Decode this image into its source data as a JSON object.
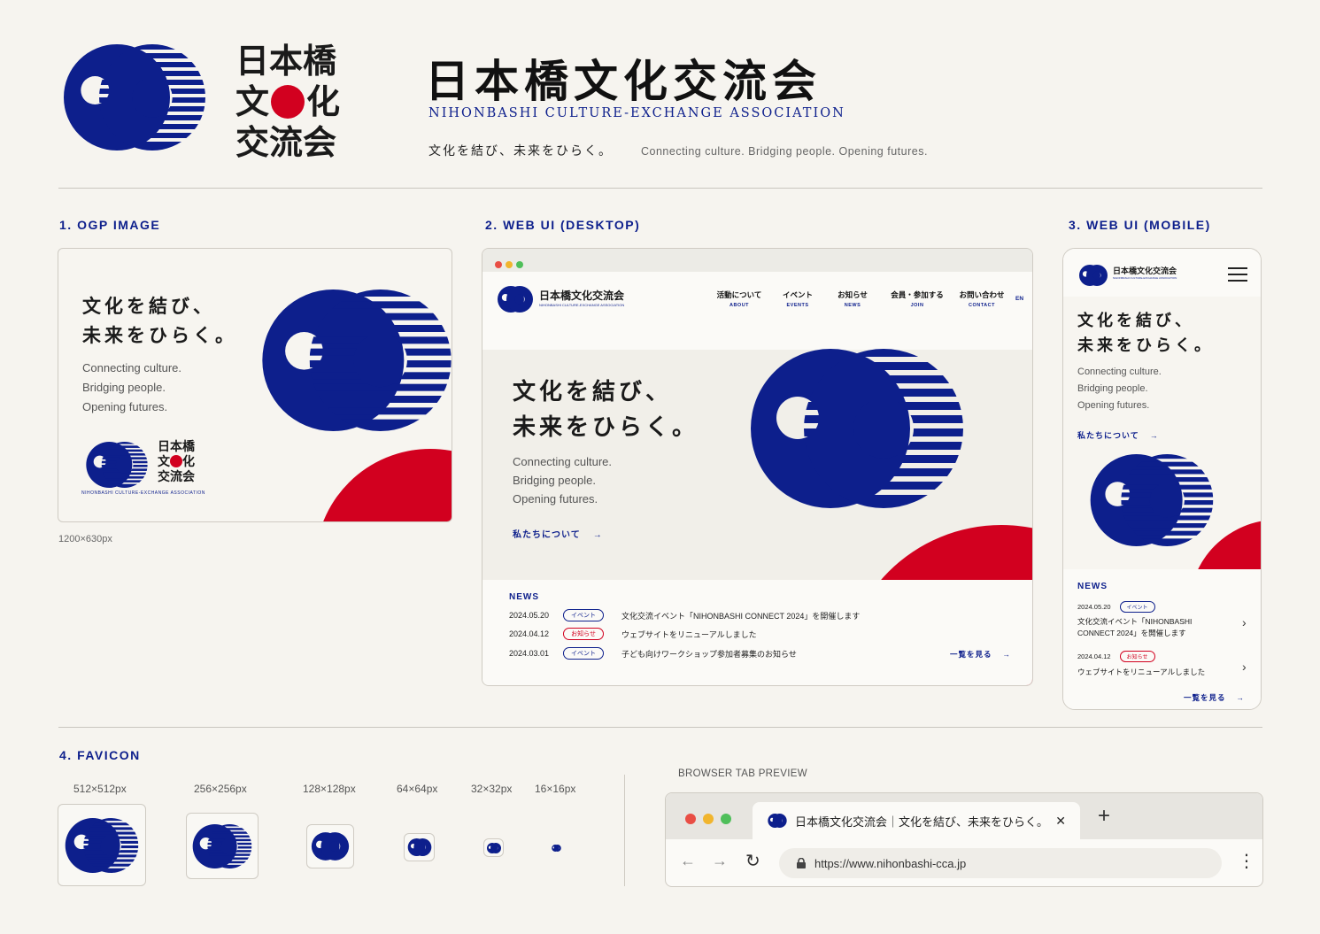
{
  "brand": {
    "logo_chars": [
      "日本橋",
      "文",
      "化",
      "交流会"
    ],
    "title": "日本橋文化交流会",
    "title_en": "NIHONBASHI CULTURE-EXCHANGE ASSOCIATION",
    "tagline_jp": "文化を結び、未来をひらく。",
    "tagline_en": "Connecting culture. Bridging people. Opening futures."
  },
  "colors": {
    "navy": "#0d1f8c",
    "red": "#d2001f",
    "paper": "#f6f4ef"
  },
  "sections": {
    "ogp": "1.  OGP IMAGE",
    "desktop": "2.  WEB UI (DESKTOP)",
    "mobile": "3.  WEB UI (MOBILE)",
    "favicon": "4.  FAVICON",
    "browser_preview": "BROWSER TAB PREVIEW"
  },
  "ogp": {
    "line1": "文化を結び、",
    "line2": "未来をひらく。",
    "en1": "Connecting culture.",
    "en2": "Bridging people.",
    "en3": "Opening futures.",
    "logo_line1": "日本橋",
    "logo_line2a": "文",
    "logo_line2b": "化",
    "logo_line3": "交流会",
    "logo_en": "NIHONBASHI CULTURE-EXCHANGE ASSOCIATION",
    "size": "1200×630px"
  },
  "desktop": {
    "logo_text": "日本橋文化交流会",
    "logo_en": "NIHONBASHI CULTURE-EXCHANGE ASSOCIATION",
    "nav": [
      {
        "jp": "活動について",
        "en": "ABOUT"
      },
      {
        "jp": "イベント",
        "en": "EVENTS"
      },
      {
        "jp": "お知らせ",
        "en": "NEWS"
      },
      {
        "jp": "会員・参加する",
        "en": "JOIN"
      },
      {
        "jp": "お問い合わせ",
        "en": "CONTACT"
      }
    ],
    "lang": "EN",
    "hero_line1": "文化を結び、",
    "hero_line2": "未来をひらく。",
    "hero_en1": "Connecting culture.",
    "hero_en2": "Bridging people.",
    "hero_en3": "Opening futures.",
    "cta": "私たちについて",
    "news_title": "NEWS",
    "news": [
      {
        "date": "2024.05.20",
        "tag": "イベント",
        "text": "文化交流イベント「NIHONBASHI CONNECT 2024」を開催します"
      },
      {
        "date": "2024.04.12",
        "tag": "お知らせ",
        "text": "ウェブサイトをリニューアルしました"
      },
      {
        "date": "2024.03.01",
        "tag": "イベント",
        "text": "子ども向けワークショップ参加者募集のお知らせ"
      }
    ],
    "more": "一覧を見る"
  },
  "mobile": {
    "logo_text": "日本橋文化交流会",
    "logo_en": "NIHONBASHI CULTURE-EXCHANGE ASSOCIATION",
    "hero_line1": "文化を結び、",
    "hero_line2": "未来をひらく。",
    "hero_en1": "Connecting culture.",
    "hero_en2": "Bridging people.",
    "hero_en3": "Opening futures.",
    "cta": "私たちについて",
    "news_title": "NEWS",
    "news1_date": "2024.05.20",
    "news1_tag": "イベント",
    "news1_line1": "文化交流イベント「NIHONBASHI",
    "news1_line2": "CONNECT 2024」を開催します",
    "news2_date": "2024.04.12",
    "news2_tag": "お知らせ",
    "news2_text": "ウェブサイトをリニューアルしました",
    "more": "一覧を見る"
  },
  "favicon": {
    "sizes": [
      "512×512px",
      "256×256px",
      "128×128px",
      "64×64px",
      "32×32px",
      "16×16px"
    ]
  },
  "browser": {
    "tab_title": "日本橋文化交流会｜文化を結び、未来をひらく。",
    "url": "https://www.nihonbashi-cca.jp",
    "close_glyph": "✕",
    "new_tab_glyph": "+",
    "back_glyph": "←",
    "forward_glyph": "→",
    "reload_glyph": "↻",
    "menu_glyph": "⋮"
  },
  "glyphs": {
    "arrow": "→",
    "chevron": "›"
  }
}
